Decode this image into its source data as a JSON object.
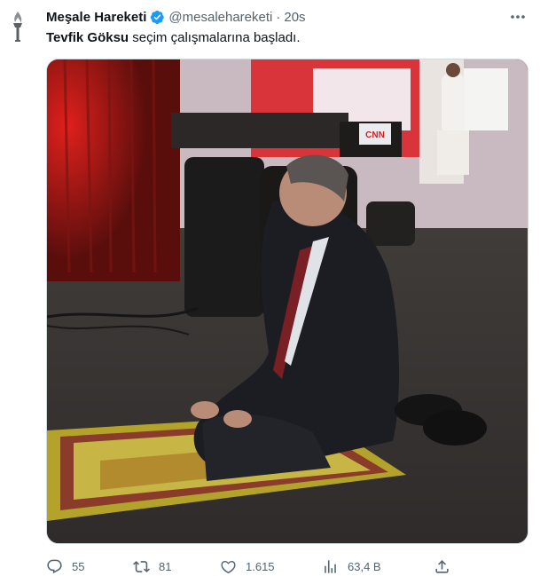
{
  "tweet": {
    "author_name": "Meşale Hareketi",
    "handle": "@mesalehareketi",
    "separator": "·",
    "time": "20s",
    "text_bold": "Tevfik Göksu",
    "text_rest": " seçim çalışmalarına başladı."
  },
  "icons": {
    "avatar": "torch-logo-icon",
    "verified": "verified-badge-icon",
    "more": "more-options-icon",
    "reply": "reply-icon",
    "retweet": "retweet-icon",
    "like": "like-heart-icon",
    "views": "views-chart-icon",
    "share": "share-icon"
  },
  "colors": {
    "verified": "#1d9bf0",
    "secondary_text": "#536471"
  },
  "actions": {
    "replies": "55",
    "retweets": "81",
    "likes": "1.615",
    "views": "63,4 B"
  },
  "media": {
    "channel_logo_text": "CNN"
  }
}
